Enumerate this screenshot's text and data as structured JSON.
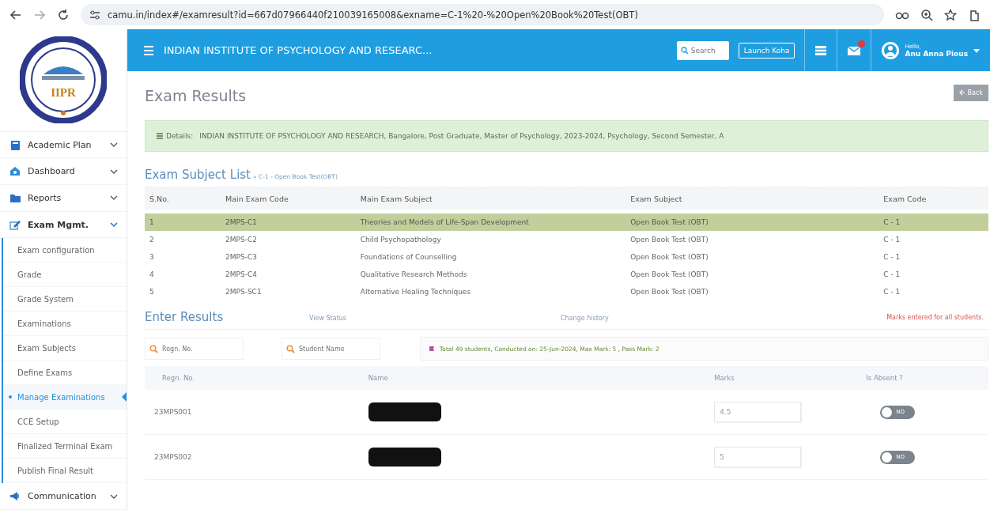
{
  "browser": {
    "url": "camu.in/index#/examresult?id=667d07966440f210039165008&exname=C-1%20-%20Open%20Book%20Test(OBT)"
  },
  "sidebar": {
    "logo_text": "IIPR",
    "items": [
      {
        "label": "Academic Plan",
        "expanded": false
      },
      {
        "label": "Dashboard",
        "expanded": false
      },
      {
        "label": "Reports",
        "expanded": false
      },
      {
        "label": "Exam Mgmt.",
        "expanded": true,
        "children": [
          {
            "label": "Exam configuration",
            "selected": false
          },
          {
            "label": "Grade",
            "selected": false
          },
          {
            "label": "Grade System",
            "selected": false
          },
          {
            "label": "Examinations",
            "selected": false
          },
          {
            "label": "Exam Subjects",
            "selected": false
          },
          {
            "label": "Define Exams",
            "selected": false
          },
          {
            "label": "Manage Examinations",
            "selected": true
          },
          {
            "label": "CCE Setup",
            "selected": false
          },
          {
            "label": "Finalized Terminal Exam",
            "selected": false
          },
          {
            "label": "Publish Final Result",
            "selected": false
          }
        ]
      },
      {
        "label": "Communication",
        "expanded": false
      }
    ]
  },
  "header": {
    "title": "INDIAN INSTITUTE OF PSYCHOLOGY AND RESEARC...",
    "search_placeholder": "Search",
    "launch_button": "Launch Koha",
    "greeting": "Hello,",
    "user": "Anu Anna Pious"
  },
  "page": {
    "title": "Exam Results",
    "back_button": "Back",
    "details": {
      "label": "Details:",
      "text": "INDIAN INSTITUTE OF PSYCHOLOGY AND RESEARCH, Bangalore, Post Graduate, Master of Psychology, 2023-2024, Psychology, Second Semester, A"
    },
    "subject_list": {
      "title": "Exam Subject List",
      "subtitle": "» C-1 - Open Book Test(OBT)",
      "columns": [
        "S.No.",
        "Main Exam Code",
        "Main Exam Subject",
        "Exam Subject",
        "Exam Code"
      ],
      "rows": [
        {
          "cells": [
            "1",
            "2MPS-C1",
            "Theories and Models of Life-Span Development",
            "Open Book Test (OBT)",
            "C - 1"
          ],
          "selected": true
        },
        {
          "cells": [
            "2",
            "2MPS-C2",
            "Child Psychopathology",
            "Open Book Test (OBT)",
            "C - 1"
          ],
          "selected": false
        },
        {
          "cells": [
            "3",
            "2MPS-C3",
            "Foundations of Counselling",
            "Open Book Test (OBT)",
            "C - 1"
          ],
          "selected": false
        },
        {
          "cells": [
            "4",
            "2MPS-C4",
            "Qualitative Research Methods",
            "Open Book Test (OBT)",
            "C - 1"
          ],
          "selected": false
        },
        {
          "cells": [
            "5",
            "2MPS-SC1",
            "Alternative Healing Techniques",
            "Open Book Test (OBT)",
            "C - 1"
          ],
          "selected": false
        }
      ]
    },
    "results": {
      "title": "Enter Results",
      "links": [
        "View Status",
        "Change history"
      ],
      "status_message": "Marks entered for all students.",
      "filters": [
        {
          "placeholder": "Regn. No."
        },
        {
          "placeholder": "Student Name"
        }
      ],
      "info": "Total 49 students, Conducted on: 25-Jun-2024, Max Mark: 5 , Pass Mark: 2",
      "columns": [
        "Regn. No.",
        "Name",
        "Marks",
        "Is Absent ?"
      ],
      "students": [
        {
          "regn": "23MPS001",
          "marks": "4.5",
          "absent": false,
          "toggle_label": "NO"
        },
        {
          "regn": "23MPS002",
          "marks": "5",
          "absent": false,
          "toggle_label": "NO"
        }
      ]
    }
  }
}
